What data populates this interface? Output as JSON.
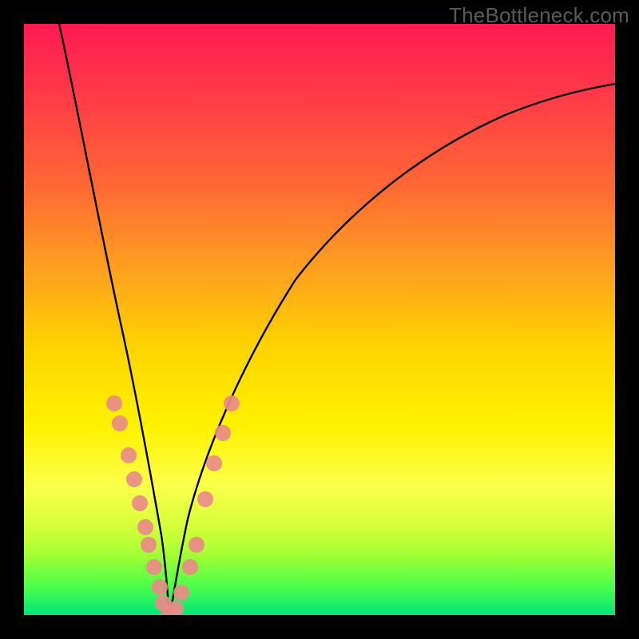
{
  "watermark": "TheBottleneck.com",
  "chart_data": {
    "type": "line",
    "title": "",
    "xlabel": "",
    "ylabel": "",
    "xlim": [
      0,
      100
    ],
    "ylim": [
      0,
      100
    ],
    "notes": "Axes are unlabeled; values below are pixel-read estimates scaled to 0-100 on each axis. Curve shows a deep V with minimum near x≈24, y≈0, rising steeply on both sides. Dots are scattered along the lower arms of the V.",
    "series": [
      {
        "name": "curve",
        "x": [
          6,
          8,
          10,
          12,
          14,
          16,
          18,
          20,
          22,
          23,
          24,
          25,
          27,
          30,
          34,
          40,
          48,
          58,
          70,
          84,
          100
        ],
        "y": [
          100,
          90,
          80,
          69,
          58,
          47,
          36,
          25,
          12,
          5,
          0,
          4,
          13,
          27,
          40,
          53,
          63,
          72,
          79,
          84,
          87
        ]
      },
      {
        "name": "dots",
        "x": [
          14.5,
          15.5,
          17,
          18,
          19,
          20,
          20.5,
          21.5,
          22.5,
          23,
          24,
          25,
          26,
          27.5,
          28.5,
          30,
          31.5,
          33,
          34.5
        ],
        "y": [
          36,
          33,
          27,
          23,
          19,
          15,
          12,
          8,
          5,
          2,
          0,
          1,
          4,
          8,
          12,
          20,
          26,
          31,
          36
        ]
      }
    ],
    "colors": {
      "curve": "#000000",
      "dots": "#e98b87",
      "gradient_top": "#ff1a53",
      "gradient_bottom": "#00e676"
    }
  }
}
